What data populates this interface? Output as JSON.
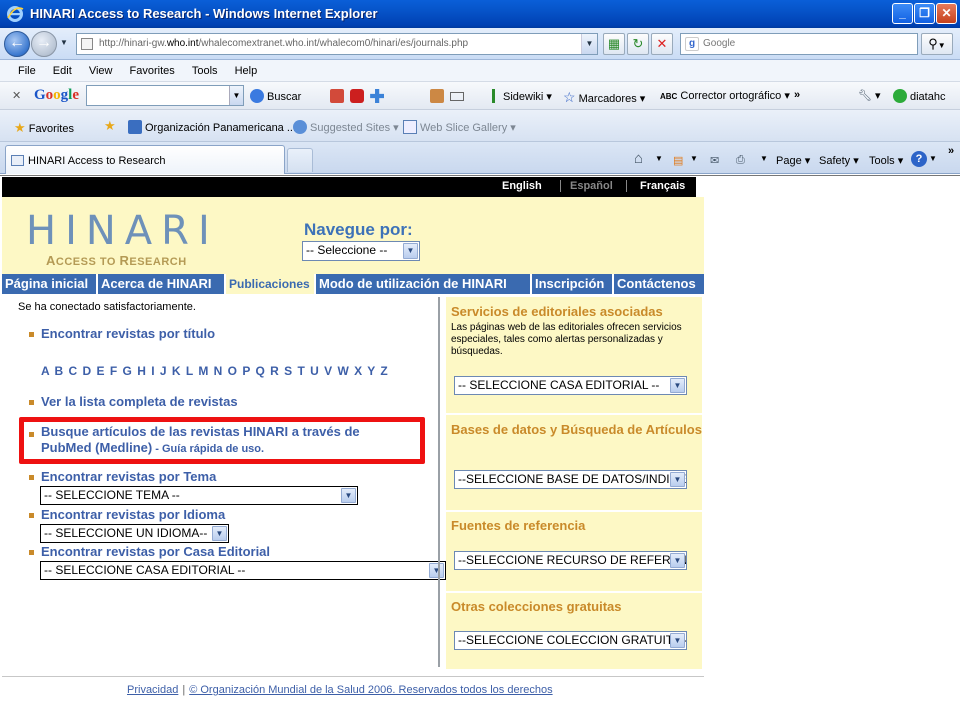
{
  "window": {
    "title": "HINARI Access to Research - Windows Internet Explorer",
    "minimize": "_",
    "maximize": "❐",
    "close": "✕"
  },
  "address": {
    "url_prefix": "http://hinari-gw.",
    "url_domain": "who.int",
    "url_suffix": "/whalecomextranet.who.int/whalecom0/hinari/es/journals.php",
    "search_placeholder": "Google"
  },
  "menu": [
    "File",
    "Edit",
    "View",
    "Favorites",
    "Tools",
    "Help"
  ],
  "google_toolbar": {
    "close": "✕",
    "logo": "Google",
    "search_button": "Buscar",
    "sidewiki": "Sidewiki",
    "bookmarks": "Marcadores",
    "spellcheck": "Corrector ortográfico",
    "user": "diatahc"
  },
  "favorites_bar": {
    "favorites": "Favorites",
    "item1": "Organización Panamericana ...",
    "item2": "Suggested Sites",
    "item3": "Web Slice Gallery"
  },
  "tab": {
    "title": "HINARI Access to Research"
  },
  "command_bar": {
    "page": "Page",
    "safety": "Safety",
    "tools": "Tools",
    "help": "?"
  },
  "site": {
    "languages": [
      "English",
      "Español",
      "Français"
    ],
    "logo_text": "HINARI",
    "logo_sub_a": "A",
    "logo_sub_b": "CCESS TO ",
    "logo_sub_c": "R",
    "logo_sub_d": "ESEARCH",
    "browse_label": "Navegue por:",
    "browse_select": "-- Seleccione --",
    "nav": [
      "Página inicial",
      "Acerca de HINARI",
      "Publicaciones",
      "Modo de utilización de HINARI",
      "Inscripción",
      "Contáctenos"
    ],
    "connected_msg": "Se ha conectado satisfactoriamente.",
    "find_by_title": "Encontrar revistas por título",
    "alphabet": "A B C D E F G H I J K L M N O P Q R S T U V W X Y Z",
    "full_list": "Ver la lista completa de revistas",
    "pubmed_line1": "Busque artículos de las revistas HINARI a través de",
    "pubmed_line2": "PubMed (Medline)",
    "pubmed_guide": " - Guía rápida de uso.",
    "by_subject": "Encontrar revistas por Tema",
    "subject_select": "-- SELECCIONE TEMA --",
    "by_language": "Encontrar revistas por Idioma",
    "language_select": "-- SELECCIONE UN IDIOMA--",
    "by_publisher": "Encontrar revistas por Casa Editorial",
    "publisher_select": "-- SELECCIONE CASA EDITORIAL --",
    "right": {
      "publishers_title": "Servicios de editoriales asociadas",
      "publishers_desc": "Las páginas web de las editoriales ofrecen servicios especiales, tales como alertas personalizadas y búsquedas.",
      "publishers_select": "-- SELECCIONE CASA EDITORIAL --",
      "databases_title": "Bases de datos y Búsqueda de Artículos",
      "databases_select": "--SELECCIONE BASE DE DATOS/INDICE--",
      "reference_title": "Fuentes de referencia",
      "reference_select": "--SELECCIONE RECURSO DE REFERENCIA--",
      "free_title": "Otras colecciones gratuitas",
      "free_select": "--SELECCIONE COLECCION GRATUITA--"
    },
    "footer_privacy": "Privacidad",
    "footer_sep": "|",
    "footer_copyright": "© Organización Mundial de la Salud 2006. Reservados todos los derechos"
  }
}
